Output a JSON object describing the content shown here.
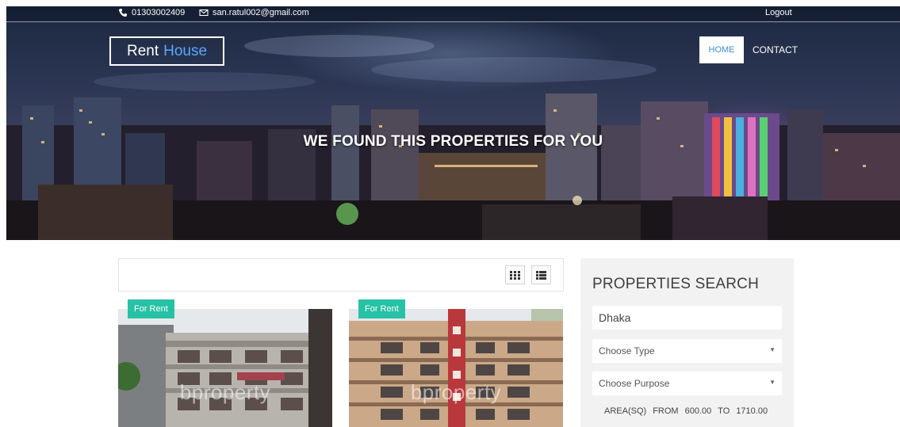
{
  "topbar": {
    "phone": "01303002409",
    "email": "san.ratul002@gmail.com",
    "logout_label": "Logout",
    "phone_icon": "phone-icon",
    "email_icon": "envelope-icon"
  },
  "brand": {
    "first": "Rent",
    "second": "House"
  },
  "nav": {
    "home": "HOME",
    "contact": "CONTACT"
  },
  "hero": {
    "title": "WE FOUND THIS PROPERTIES FOR YOU"
  },
  "view_toggle": {
    "grid_icon": "grid-view-icon",
    "list_icon": "list-view-icon"
  },
  "listings": [
    {
      "badge": "For Rent",
      "watermark": "bproperty"
    },
    {
      "badge": "For Rent",
      "watermark": "bproperty"
    }
  ],
  "search": {
    "title": "PROPERTIES SEARCH",
    "location_value": "Dhaka",
    "type_placeholder": "Choose Type",
    "purpose_placeholder": "Choose Purpose",
    "area_label": "AREA(SQ)",
    "from_label": "FROM",
    "from_value": "600.00",
    "to_label": "TO",
    "to_value": "1710.00"
  },
  "colors": {
    "accent": "#27c2a5",
    "brand_blue": "#5aa7ff",
    "nav_active_text": "#3a8fd8"
  }
}
